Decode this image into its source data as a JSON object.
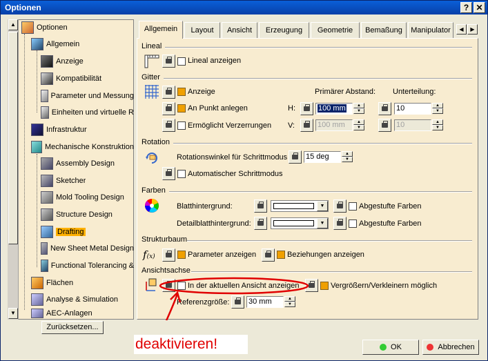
{
  "window": {
    "title": "Optionen",
    "help_label": "?",
    "close_label": "✕"
  },
  "tree": {
    "items": [
      {
        "label": "Optionen"
      },
      {
        "label": "Allgemein"
      },
      {
        "label": "Anzeige"
      },
      {
        "label": "Kompatibilität"
      },
      {
        "label": "Parameter und Messung"
      },
      {
        "label": "Einheiten und virtuelle R"
      },
      {
        "label": "Infrastruktur"
      },
      {
        "label": "Mechanische Konstruktion"
      },
      {
        "label": "Assembly Design"
      },
      {
        "label": "Sketcher"
      },
      {
        "label": "Mold Tooling Design"
      },
      {
        "label": "Structure Design"
      },
      {
        "label": "Drafting"
      },
      {
        "label": "New Sheet Metal Design"
      },
      {
        "label": "Functional Tolerancing &"
      },
      {
        "label": "Flächen"
      },
      {
        "label": "Analyse & Simulation"
      },
      {
        "label": "AEC-Anlagen"
      }
    ],
    "reset_label": "Zurücksetzen..."
  },
  "tabs": [
    "Allgemein",
    "Layout",
    "Ansicht",
    "Erzeugung",
    "Geometrie",
    "Bemaßung",
    "Manipulator"
  ],
  "lineal": {
    "title": "Lineal",
    "show_label": "Lineal anzeigen"
  },
  "gitter": {
    "title": "Gitter",
    "anzeige_label": "Anzeige",
    "anpunkt_label": "An Punkt anlegen",
    "verzerrungen_label": "Ermöglicht Verzerrungen",
    "primary_label": "Primärer Abstand:",
    "sub_label": "Unterteilung:",
    "h_label": "H:",
    "v_label": "V:",
    "h_value": "100 mm",
    "v_value": "100 mm",
    "h_sub": "10",
    "v_sub": "10"
  },
  "rotation": {
    "title": "Rotation",
    "angle_label": "Rotationswinkel für Schrittmodus",
    "angle_value": "15 deg",
    "auto_label": "Automatischer Schrittmodus"
  },
  "farben": {
    "title": "Farben",
    "blatt_label": "Blatthintergrund:",
    "detail_label": "Detailblatthintergrund:",
    "gradient1": "Abgestufte Farben",
    "gradient2": "Abgestufte Farben"
  },
  "struktur": {
    "title": "Strukturbaum",
    "params_label": "Parameter anzeigen",
    "relations_label": "Beziehungen anzeigen"
  },
  "ansichtsachse": {
    "title": "Ansichtsachse",
    "current_label": "In der aktuellen Ansicht anzeigen",
    "zoom_label": "Vergrößern/Verkleinern möglich",
    "ref_label": "Referenzgröße:",
    "ref_value": "30 mm"
  },
  "buttons": {
    "ok": "OK",
    "cancel": "Abbrechen"
  },
  "annotation": {
    "text": "deaktivieren!"
  },
  "colors": {
    "annotation_red": "#e00000",
    "selection_orange": "#ffb000",
    "panel_bg": "#f8ecd0"
  }
}
